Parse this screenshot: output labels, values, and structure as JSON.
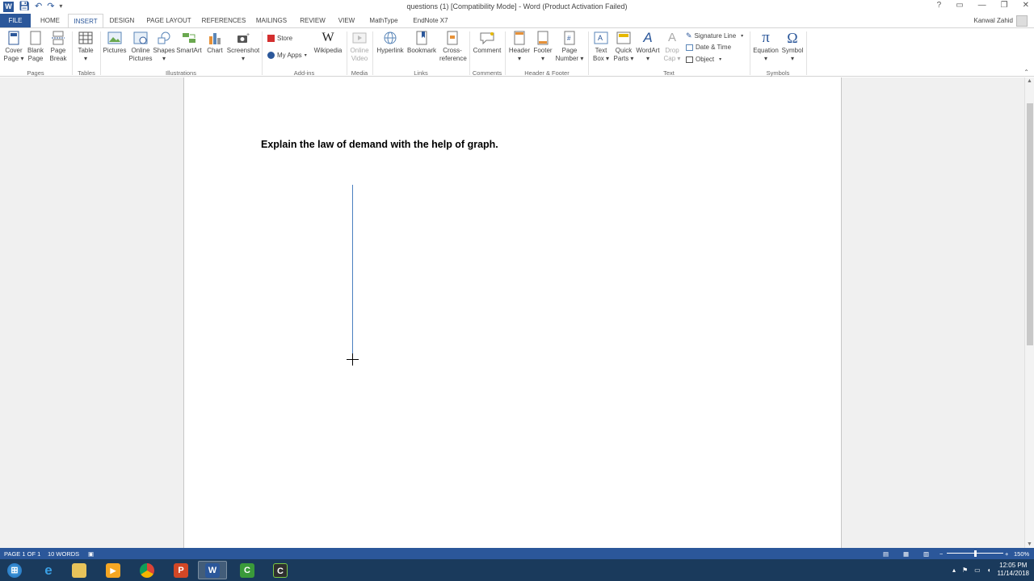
{
  "titlebar": {
    "title": "questions (1) [Compatibility Mode] - Word (Product Activation Failed)",
    "word_icon": "W",
    "save_icon": "save-icon",
    "undo_icon": "undo-icon",
    "redo_icon": "redo-icon",
    "help": "?",
    "ribbon_opts": "▭",
    "minimize": "—",
    "restore": "❐",
    "close": "✕"
  },
  "tabs": {
    "file": "FILE",
    "home": "HOME",
    "insert": "INSERT",
    "design": "DESIGN",
    "page_layout": "PAGE LAYOUT",
    "references": "REFERENCES",
    "mailings": "MAILINGS",
    "review": "REVIEW",
    "view": "VIEW",
    "mathtype": "MathType",
    "endnote": "EndNote X7",
    "user": "Kanwal Zahid"
  },
  "ribbon": {
    "cover_page": [
      "Cover",
      "Page ▾"
    ],
    "blank_page": [
      "Blank",
      "Page"
    ],
    "page_break": [
      "Page",
      "Break"
    ],
    "table": [
      "Table",
      "▾"
    ],
    "pictures": "Pictures",
    "online_pictures": [
      "Online",
      "Pictures"
    ],
    "shapes": [
      "Shapes",
      "▾"
    ],
    "smartart": "SmartArt",
    "chart": "Chart",
    "screenshot": [
      "Screenshot",
      "▾"
    ],
    "store": "Store",
    "my_apps": "My Apps",
    "wikipedia": "Wikipedia",
    "online_video": [
      "Online",
      "Video"
    ],
    "hyperlink": "Hyperlink",
    "bookmark": "Bookmark",
    "cross_reference": [
      "Cross-",
      "reference"
    ],
    "comment": "Comment",
    "header": [
      "Header",
      "▾"
    ],
    "footer": [
      "Footer",
      "▾"
    ],
    "page_number": [
      "Page",
      "Number ▾"
    ],
    "text_box": [
      "Text",
      "Box ▾"
    ],
    "quick_parts": [
      "Quick",
      "Parts ▾"
    ],
    "wordart": [
      "WordArt",
      "▾"
    ],
    "drop_cap": [
      "Drop",
      "Cap ▾"
    ],
    "signature_line": "Signature Line",
    "date_time": "Date & Time",
    "object": "Object",
    "equation": [
      "Equation",
      "▾"
    ],
    "symbol": [
      "Symbol",
      "▾"
    ],
    "groups": {
      "pages": "Pages",
      "tables": "Tables",
      "illustrations": "Illustrations",
      "addins": "Add-ins",
      "media": "Media",
      "links": "Links",
      "comments": "Comments",
      "header_footer": "Header & Footer",
      "text": "Text",
      "symbols": "Symbols"
    }
  },
  "document": {
    "question": "Explain the law of demand with the help of graph."
  },
  "statusbar": {
    "page": "PAGE 1 OF 1",
    "words": "10 WORDS",
    "zoom": "150%"
  },
  "taskbar": {
    "clock_time": "12:05 PM",
    "clock_date": "11/14/2018"
  },
  "colors": {
    "accent": "#2b579a",
    "taskbar": "#1a3a5c",
    "line": "#4a7fc0"
  }
}
